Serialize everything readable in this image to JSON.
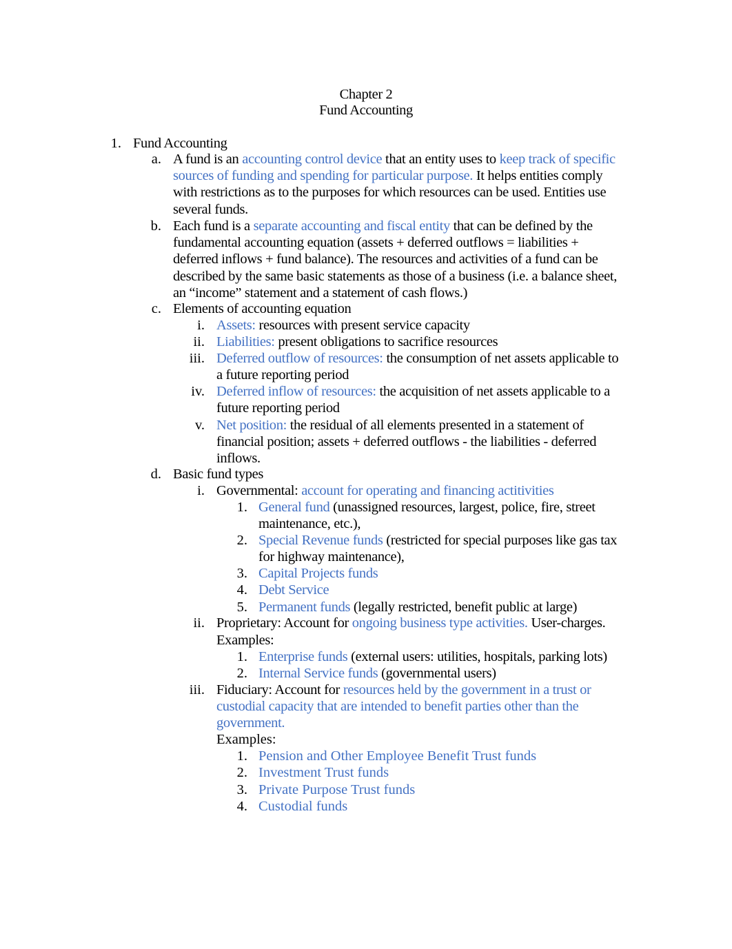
{
  "document": {
    "chapter": "Chapter 2",
    "title": "Fund Accounting",
    "colors": {
      "highlight": "#4472c4",
      "text": "#000000"
    },
    "section1": {
      "marker": "1.",
      "heading": "Fund Accounting",
      "a": {
        "marker": "a.",
        "lines": [
          [
            {
              "t": "A fund is an "
            },
            {
              "t": "accounting control device",
              "h": 1
            },
            {
              "t": " that an entity uses to "
            },
            {
              "t": "keep track of specific",
              "h": 1
            }
          ],
          [
            {
              "t": "sources of funding and spending for particular purpose.",
              "h": 1
            },
            {
              "t": " It helps entities comply"
            }
          ],
          [
            {
              "t": "with restrictions as to the purposes for which resources can be used.  Entities use"
            }
          ],
          [
            {
              "t": "several funds."
            }
          ]
        ]
      },
      "b": {
        "marker": "b.",
        "lines": [
          [
            {
              "t": "Each fund is a "
            },
            {
              "t": "separate accounting and fiscal entity",
              "h": 1
            },
            {
              "t": " that can be defined by the"
            }
          ],
          [
            {
              "t": "fundamental accounting equation (assets + deferred outflows = liabilities +"
            }
          ],
          [
            {
              "t": "deferred inflows + fund balance).  The resources and activities of a fund can be"
            }
          ],
          [
            {
              "t": "described by the same basic statements as those of a business (i.e. a balance sheet,"
            }
          ],
          [
            {
              "t": "an “income” statement and a statement of cash flows.)"
            }
          ]
        ]
      },
      "c": {
        "marker": "c.",
        "heading": "Elements of accounting equation",
        "items": [
          {
            "marker": "i.",
            "lines": [
              [
                {
                  "t": "Assets:",
                  "h": 1
                },
                {
                  "t": " resources with present service capacity"
                }
              ]
            ]
          },
          {
            "marker": "ii.",
            "lines": [
              [
                {
                  "t": "Liabilities:",
                  "h": 1
                },
                {
                  "t": " present obligations to sacrifice resources"
                }
              ]
            ]
          },
          {
            "marker": "iii.",
            "lines": [
              [
                {
                  "t": "Deferred outflow of resources:",
                  "h": 1
                },
                {
                  "t": " the consumption of net assets applicable to"
                }
              ],
              [
                {
                  "t": "a future reporting period"
                }
              ]
            ]
          },
          {
            "marker": "iv.",
            "lines": [
              [
                {
                  "t": "Deferred inflow of resources:",
                  "h": 1
                },
                {
                  "t": " the acquisition of net assets applicable to a"
                }
              ],
              [
                {
                  "t": "future reporting period"
                }
              ]
            ]
          },
          {
            "marker": "v.",
            "lines": [
              [
                {
                  "t": "Net position:",
                  "h": 1
                },
                {
                  "t": " the residual of all elements presented in a statement of"
                }
              ],
              [
                {
                  "t": "financial position; assets + deferred outflows - the liabilities - deferred"
                }
              ],
              [
                {
                  "t": "inflows."
                }
              ]
            ]
          }
        ]
      },
      "d": {
        "marker": "d.",
        "heading": "Basic fund types",
        "governmental": {
          "marker": "i.",
          "line": [
            {
              "t": "Governmental: "
            },
            {
              "t": "account for operating and financing actitivities",
              "h": 1
            }
          ],
          "funds": [
            {
              "marker": "1.",
              "lines": [
                [
                  {
                    "t": "General fund",
                    "h": 1
                  },
                  {
                    "t": " (unassigned resources, largest, police, fire, street"
                  }
                ],
                [
                  {
                    "t": "maintenance, etc.),"
                  }
                ]
              ]
            },
            {
              "marker": "2.",
              "lines": [
                [
                  {
                    "t": "Special Revenue funds",
                    "h": 1
                  },
                  {
                    "t": " (restricted for special purposes like gas tax"
                  }
                ],
                [
                  {
                    "t": "for highway maintenance),"
                  }
                ]
              ]
            },
            {
              "marker": "3.",
              "lines": [
                [
                  {
                    "t": "Capital Projects funds",
                    "h": 1
                  }
                ]
              ]
            },
            {
              "marker": "4.",
              "lines": [
                [
                  {
                    "t": "Debt Service",
                    "h": 1
                  }
                ]
              ]
            },
            {
              "marker": "5.",
              "lines": [
                [
                  {
                    "t": "Permanent funds",
                    "h": 1
                  },
                  {
                    "t": " (legally restricted, benefit public at large)"
                  }
                ]
              ]
            }
          ]
        },
        "proprietary": {
          "marker": "ii.",
          "line": [
            {
              "t": "Proprietary:  Account for "
            },
            {
              "t": "ongoing business type activities.",
              "h": 1
            },
            {
              "t": " User-charges."
            }
          ],
          "examples_label": "Examples:",
          "funds": [
            {
              "marker": "1.",
              "lines": [
                [
                  {
                    "t": "Enterprise funds",
                    "h": 1
                  },
                  {
                    "t": " (external users:  utilities, hospitals, parking lots)"
                  }
                ]
              ]
            },
            {
              "marker": "2.",
              "lines": [
                [
                  {
                    "t": "Internal Service funds",
                    "h": 1
                  },
                  {
                    "t": " (governmental users)"
                  }
                ]
              ]
            }
          ]
        },
        "fiduciary": {
          "marker": "iii.",
          "lines": [
            [
              {
                "t": "Fiduciary:  Account for "
              },
              {
                "t": "resources held by the government in a trust or",
                "h": 1
              }
            ],
            [
              {
                "t": "custodial capacity that are intended to benefit parties other than the",
                "h": 1
              }
            ],
            [
              {
                "t": "government.",
                "h": 1
              }
            ]
          ],
          "examples_label": "Examples:",
          "funds": [
            {
              "marker": "1.",
              "lines": [
                [
                  {
                    "t": "Pension and Other Employee Benefit Trust funds",
                    "h": 1
                  }
                ]
              ]
            },
            {
              "marker": "2.",
              "lines": [
                [
                  {
                    "t": "Investment Trust funds",
                    "h": 1
                  }
                ]
              ]
            },
            {
              "marker": "3.",
              "lines": [
                [
                  {
                    "t": "Private Purpose Trust funds",
                    "h": 1
                  }
                ]
              ]
            },
            {
              "marker": "4.",
              "lines": [
                [
                  {
                    "t": "Custodial funds",
                    "h": 1
                  }
                ]
              ]
            }
          ]
        }
      }
    }
  }
}
